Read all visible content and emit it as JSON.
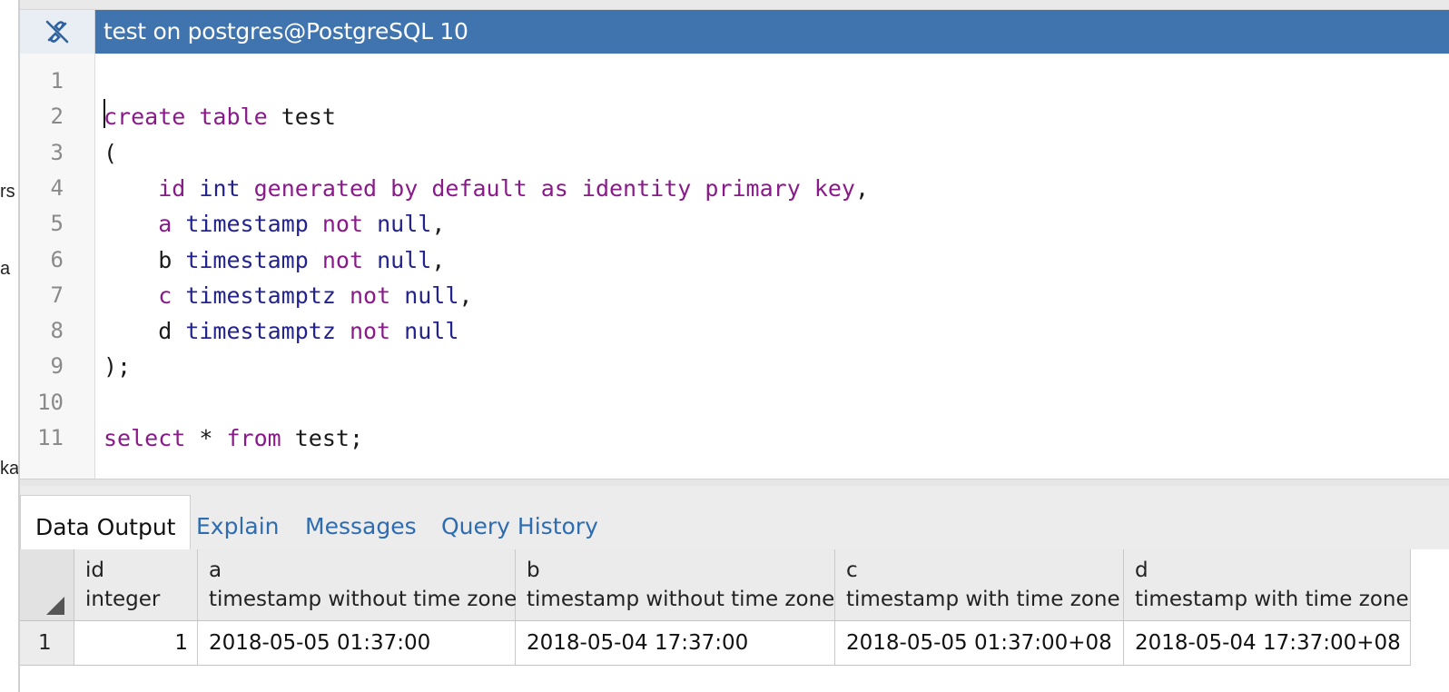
{
  "left_fragments": [
    "rs",
    "a",
    "ka"
  ],
  "title": {
    "text": "test on postgres@PostgreSQL 10",
    "icon": "disconnected-plug-icon"
  },
  "editor": {
    "line_numbers": [
      "1",
      "2",
      "3",
      "4",
      "5",
      "6",
      "7",
      "8",
      "9",
      "10",
      "11"
    ],
    "lines": [
      [],
      [
        [
          "kw",
          "create"
        ],
        [
          "",
          " "
        ],
        [
          "kw",
          "table"
        ],
        [
          "",
          " test"
        ]
      ],
      [
        [
          "",
          "("
        ]
      ],
      [
        [
          "",
          "    "
        ],
        [
          "kw",
          "id"
        ],
        [
          "",
          " "
        ],
        [
          "ty",
          "int"
        ],
        [
          "",
          " "
        ],
        [
          "kw",
          "generated"
        ],
        [
          "",
          " "
        ],
        [
          "kw",
          "by"
        ],
        [
          "",
          " "
        ],
        [
          "kw",
          "default"
        ],
        [
          "",
          " "
        ],
        [
          "kw",
          "as"
        ],
        [
          "",
          " "
        ],
        [
          "kw",
          "identity"
        ],
        [
          "",
          " "
        ],
        [
          "kw",
          "primary"
        ],
        [
          "",
          " "
        ],
        [
          "kw",
          "key"
        ],
        [
          "",
          ","
        ]
      ],
      [
        [
          "",
          "    "
        ],
        [
          "kw",
          "a"
        ],
        [
          "",
          " "
        ],
        [
          "ty",
          "timestamp"
        ],
        [
          "",
          " "
        ],
        [
          "kw",
          "not"
        ],
        [
          "",
          " "
        ],
        [
          "ty",
          "null"
        ],
        [
          "",
          ","
        ]
      ],
      [
        [
          "",
          "    b "
        ],
        [
          "ty",
          "timestamp"
        ],
        [
          "",
          " "
        ],
        [
          "kw",
          "not"
        ],
        [
          "",
          " "
        ],
        [
          "ty",
          "null"
        ],
        [
          "",
          ","
        ]
      ],
      [
        [
          "",
          "    "
        ],
        [
          "kw",
          "c"
        ],
        [
          "",
          " "
        ],
        [
          "ty",
          "timestamptz"
        ],
        [
          "",
          " "
        ],
        [
          "kw",
          "not"
        ],
        [
          "",
          " "
        ],
        [
          "ty",
          "null"
        ],
        [
          "",
          ","
        ]
      ],
      [
        [
          "",
          "    d "
        ],
        [
          "ty",
          "timestamptz"
        ],
        [
          "",
          " "
        ],
        [
          "kw",
          "not"
        ],
        [
          "",
          " "
        ],
        [
          "ty",
          "null"
        ]
      ],
      [
        [
          "",
          ");"
        ]
      ],
      [],
      [
        [
          "kw",
          "select"
        ],
        [
          "",
          " * "
        ],
        [
          "kw",
          "from"
        ],
        [
          "",
          " test;"
        ]
      ]
    ]
  },
  "tabs": [
    {
      "label": "Data Output",
      "active": true
    },
    {
      "label": "Explain",
      "active": false
    },
    {
      "label": "Messages",
      "active": false
    },
    {
      "label": "Query History",
      "active": false
    }
  ],
  "grid": {
    "columns": [
      {
        "name": "id",
        "type": "integer"
      },
      {
        "name": "a",
        "type": "timestamp without time zone"
      },
      {
        "name": "b",
        "type": "timestamp without time zone"
      },
      {
        "name": "c",
        "type": "timestamp with time zone"
      },
      {
        "name": "d",
        "type": "timestamp with time zone"
      }
    ],
    "rows": [
      {
        "num": "1",
        "cells": [
          "1",
          "2018-05-05 01:37:00",
          "2018-05-04 17:37:00",
          "2018-05-05 01:37:00+08",
          "2018-05-04 17:37:00+08"
        ]
      }
    ]
  },
  "colors": {
    "title_bar": "#3f74ae",
    "keyword": "#8a1a8a",
    "type": "#23238f",
    "tab_link": "#2e6cb0"
  }
}
